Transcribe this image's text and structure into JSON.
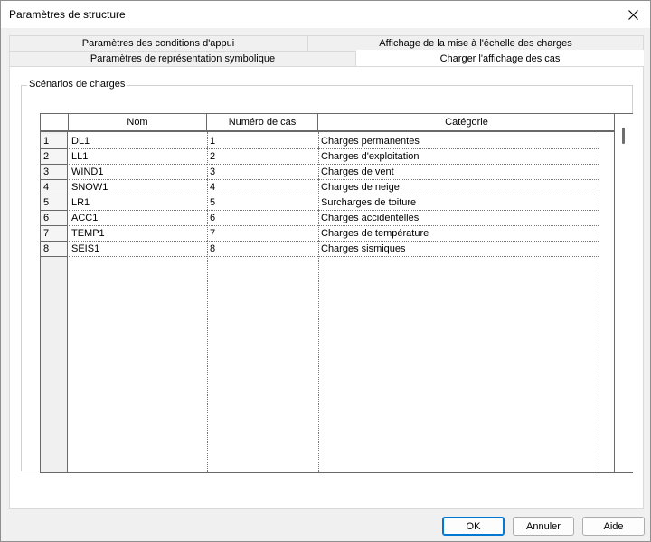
{
  "window": {
    "title": "Paramètres de structure"
  },
  "tabs": [
    {
      "label": "Paramètres des conditions d'appui"
    },
    {
      "label": "Affichage de la mise à l'échelle des charges"
    },
    {
      "label": "Paramètres de représentation symbolique"
    },
    {
      "label": "Charger l'affichage des cas"
    }
  ],
  "group": {
    "label": "Scénarios de charges"
  },
  "table": {
    "columns": [
      "Nom",
      "Numéro de cas",
      "Catégorie"
    ],
    "rows": [
      {
        "num": "1",
        "nom": "DL1",
        "numero": "1",
        "categorie": "Charges permanentes"
      },
      {
        "num": "2",
        "nom": "LL1",
        "numero": "2",
        "categorie": "Charges d'exploitation"
      },
      {
        "num": "3",
        "nom": "WIND1",
        "numero": "3",
        "categorie": "Charges de vent"
      },
      {
        "num": "4",
        "nom": "SNOW1",
        "numero": "4",
        "categorie": "Charges de neige"
      },
      {
        "num": "5",
        "nom": "LR1",
        "numero": "5",
        "categorie": "Surcharges de toiture"
      },
      {
        "num": "6",
        "nom": "ACC1",
        "numero": "6",
        "categorie": "Charges accidentelles"
      },
      {
        "num": "7",
        "nom": "TEMP1",
        "numero": "7",
        "categorie": "Charges de température"
      },
      {
        "num": "8",
        "nom": "SEIS1",
        "numero": "8",
        "categorie": "Charges sismiques"
      }
    ]
  },
  "buttons": {
    "ok": "OK",
    "cancel": "Annuler",
    "help": "Aide"
  },
  "icons": {
    "close": "close-icon"
  },
  "colors": {
    "accent": "#0078d4",
    "grid_border": "#696969"
  }
}
